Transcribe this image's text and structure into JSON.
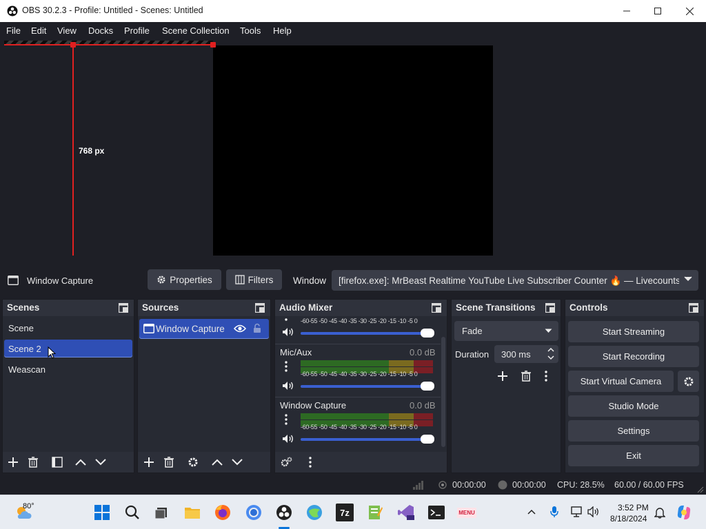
{
  "window": {
    "title": "OBS 30.2.3 - Profile: Untitled - Scenes: Untitled",
    "minimize": "minimize-icon",
    "maximize": "maximize-icon",
    "close": "close-icon"
  },
  "menu": [
    "File",
    "Edit",
    "View",
    "Docks",
    "Profile",
    "Scene Collection",
    "Tools",
    "Help"
  ],
  "preview": {
    "guide_label": "768 px"
  },
  "source_toolbar": {
    "source_name": "Window Capture",
    "properties_label": "Properties",
    "filters_label": "Filters",
    "window_label": "Window",
    "window_value": "[firefox.exe]: MrBeast Realtime YouTube Live Subscriber Counter 🔥 — Livecounts.i"
  },
  "scenes": {
    "title": "Scenes",
    "items": [
      "Scene",
      "Scene 2",
      "Weascan"
    ],
    "selected": "Scene 2"
  },
  "sources": {
    "title": "Sources",
    "items": [
      {
        "name": "Window Capture",
        "visible": true,
        "locked": false
      }
    ]
  },
  "audio_mixer": {
    "title": "Audio Mixer",
    "ticks": "-60-55 -50 -45 -40 -35 -30 -25 -20 -15 -10 -5 0",
    "channels": [
      {
        "name": "",
        "db": "",
        "volume": 1.0
      },
      {
        "name": "Mic/Aux",
        "db": "0.0 dB",
        "volume": 1.0
      },
      {
        "name": "Window Capture",
        "db": "0.0 dB",
        "volume": 1.0
      }
    ]
  },
  "transitions": {
    "title": "Scene Transitions",
    "selected": "Fade",
    "duration_label": "Duration",
    "duration_value": "300 ms"
  },
  "controls": {
    "title": "Controls",
    "start_streaming": "Start Streaming",
    "start_recording": "Start Recording",
    "start_virtual_camera": "Start Virtual Camera",
    "studio_mode": "Studio Mode",
    "settings": "Settings",
    "exit": "Exit"
  },
  "status": {
    "stream_time": "00:00:00",
    "record_time": "00:00:00",
    "cpu": "CPU: 28.5%",
    "fps": "60.00 / 60.00 FPS"
  },
  "taskbar": {
    "weather_temp": "80°",
    "time": "3:52 PM",
    "date": "8/18/2024",
    "apps": [
      "windows-start-icon",
      "search-icon",
      "task-view-icon",
      "file-explorer-icon",
      "firefox-icon",
      "chrome-icon",
      "obs-icon",
      "browser-icon",
      "7zip-icon",
      "notepad-icon",
      "visual-studio-icon",
      "terminal-icon",
      "menu-app-icon"
    ],
    "app_labels": {
      "sevenzip": "7z",
      "menu": "MENU"
    }
  },
  "colors": {
    "accent": "#2f4fb5",
    "guide": "#e02020",
    "background": "#1e1f26",
    "dock": "#272a33"
  }
}
